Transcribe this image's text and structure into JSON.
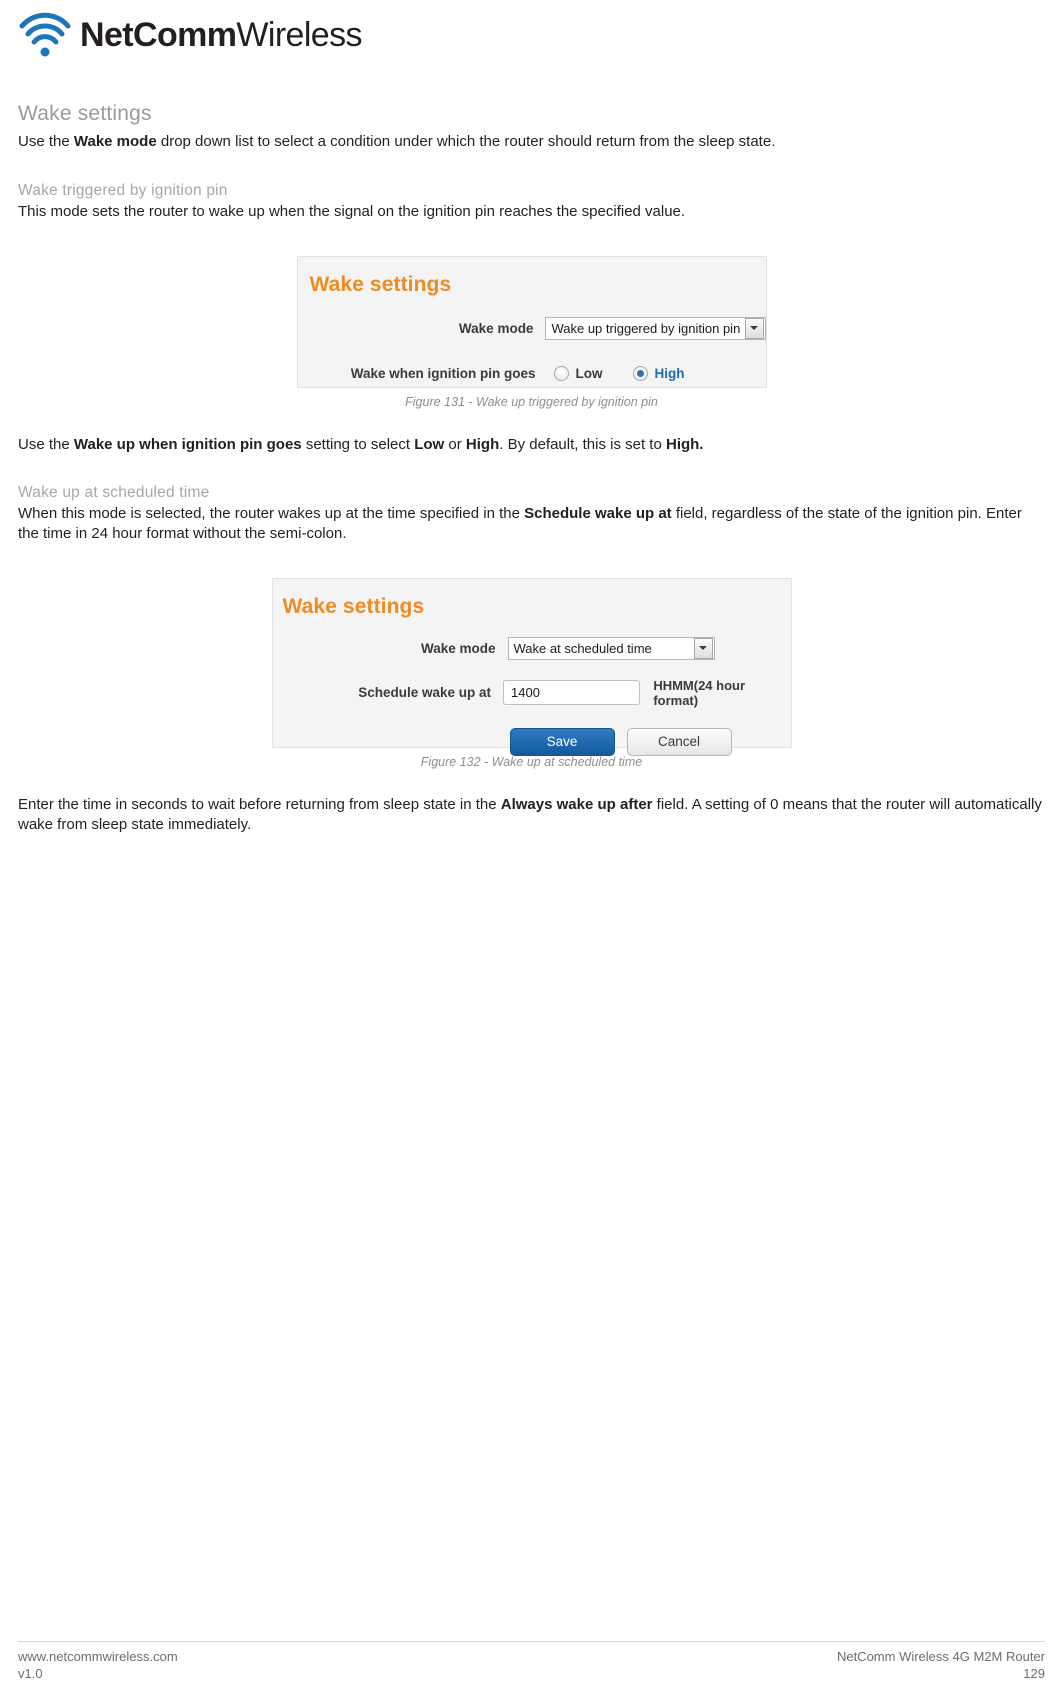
{
  "brand": {
    "logo_bold": "NetComm",
    "logo_light": "Wireless",
    "logo_icon": "wifi-signal-icon"
  },
  "content": {
    "section_title": "Wake settings",
    "intro_pre": "Use the ",
    "intro_bold": "Wake mode",
    "intro_post": " drop down list to select a condition under which the router should return from the sleep state.",
    "sub1_title": "Wake triggered by ignition pin",
    "sub1_text": "This mode sets the router to wake up when the signal on the ignition pin reaches the specified value.",
    "para2_pre": "Use the ",
    "para2_b1": "Wake up when ignition pin goes",
    "para2_mid1": " setting to select ",
    "para2_b2": "Low",
    "para2_mid2": " or ",
    "para2_b3": "High",
    "para2_mid3": ". By default, this is set to ",
    "para2_b4": "High.",
    "sub2_title": "Wake up at scheduled time",
    "para3_pre": "When this mode is selected, the router wakes up at the time specified in the ",
    "para3_bold": "Schedule wake up at",
    "para3_post": " field, regardless of the state of the ignition pin. Enter the time in 24 hour format without the semi-colon.",
    "para4_pre": "Enter the time in seconds to wait before returning from sleep state in the ",
    "para4_bold": "Always wake up after",
    "para4_post": " field. A setting of 0 means that the router will automatically wake from sleep state immediately."
  },
  "figure1": {
    "panel_title": "Wake settings",
    "wake_mode_label": "Wake mode",
    "wake_mode_value": "Wake up triggered by ignition pin",
    "pin_label": "Wake when ignition pin goes",
    "option_low": "Low",
    "option_high": "High",
    "selected_option": "High",
    "caption": "Figure 131 - Wake up triggered by ignition pin"
  },
  "figure2": {
    "panel_title": "Wake settings",
    "wake_mode_label": "Wake mode",
    "wake_mode_value": "Wake at scheduled time",
    "schedule_label": "Schedule wake up at",
    "schedule_value": "1400",
    "format_hint": "HHMM(24 hour format)",
    "save_label": "Save",
    "cancel_label": "Cancel",
    "caption": "Figure 132 - Wake up at scheduled time"
  },
  "footer": {
    "website": "www.netcommwireless.com",
    "version": "v1.0",
    "product": "NetComm Wireless 4G M2M Router",
    "page_number": "129"
  },
  "colors": {
    "accent_orange": "#f08a22",
    "heading_grey": "#9b9b9b",
    "primary_blue": "#15599c"
  }
}
